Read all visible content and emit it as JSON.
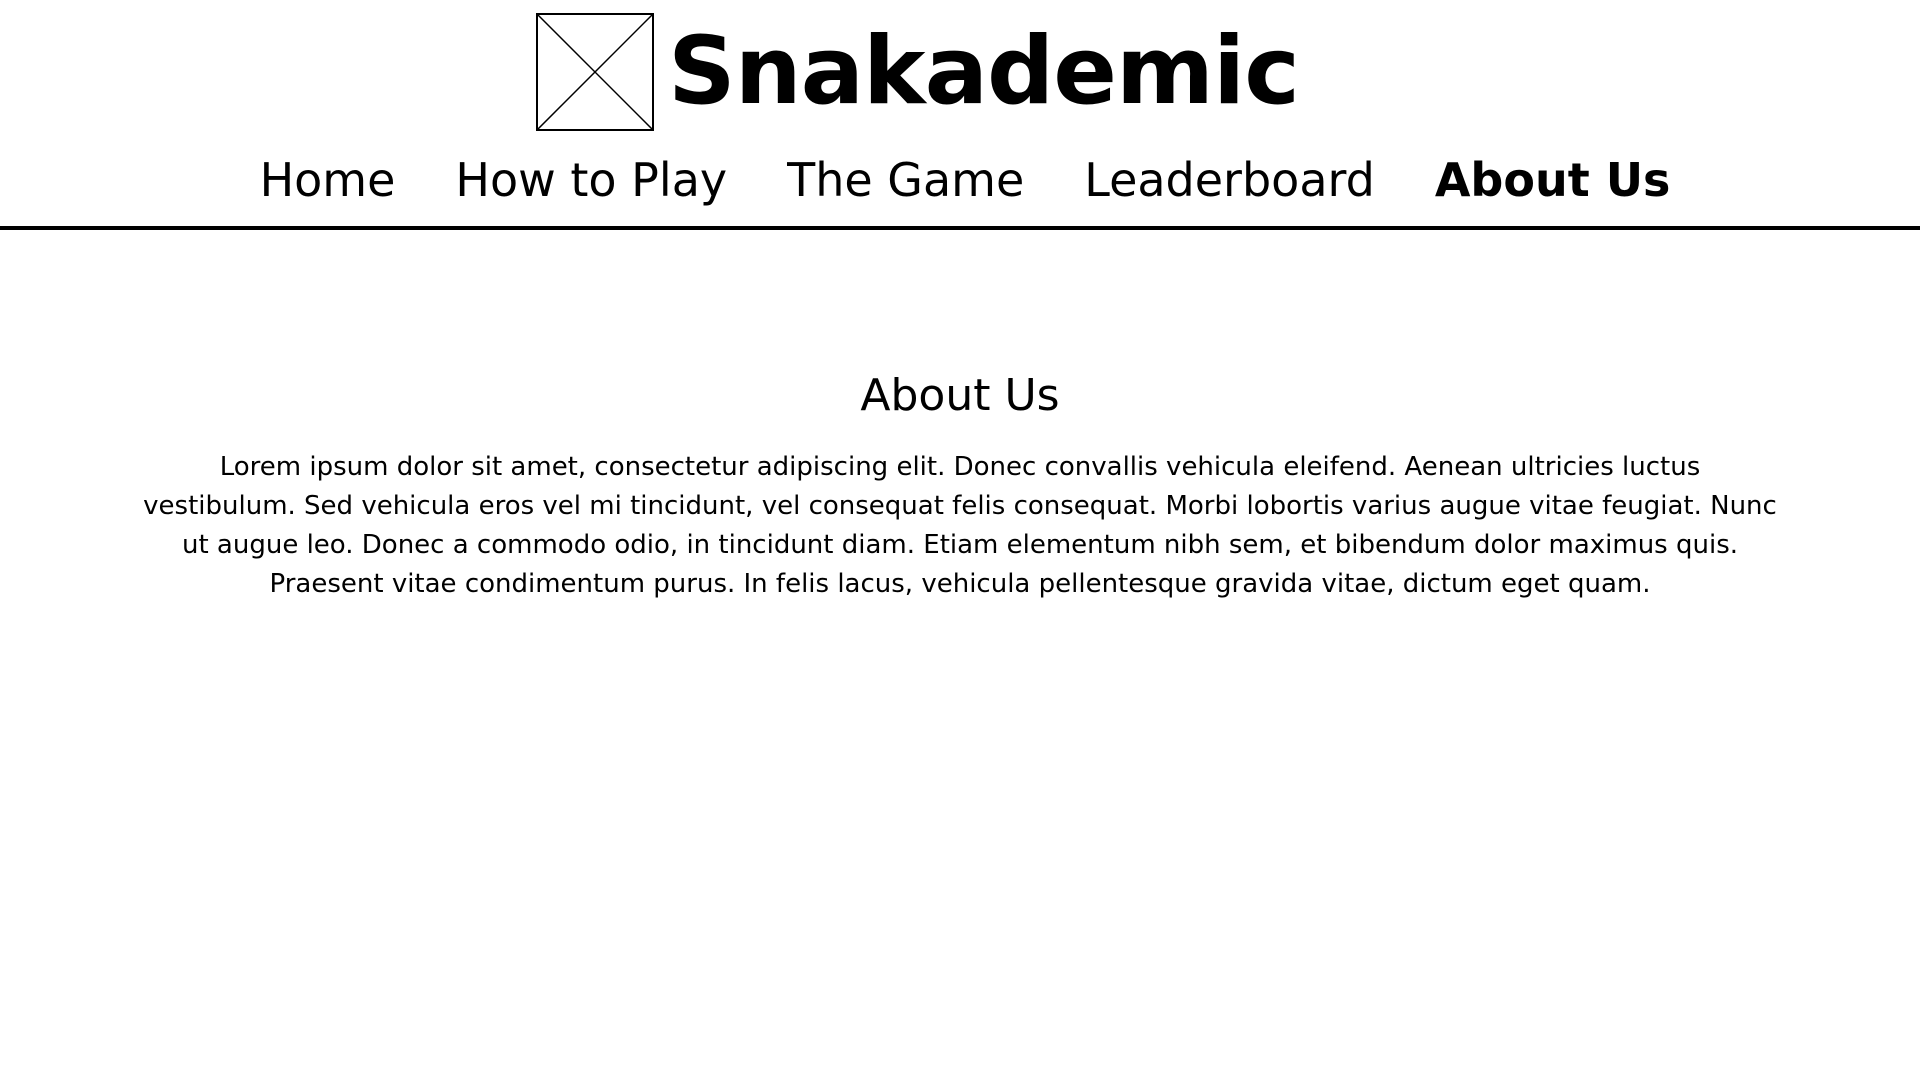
{
  "site": {
    "title": "Snakademic",
    "logo_icon": "image-placeholder-icon"
  },
  "nav": {
    "items": [
      {
        "label": "Home",
        "active": false
      },
      {
        "label": "How to Play",
        "active": false
      },
      {
        "label": "The Game",
        "active": false
      },
      {
        "label": "Leaderboard",
        "active": false
      },
      {
        "label": "About Us",
        "active": true
      }
    ]
  },
  "main": {
    "heading": "About Us",
    "paragraph": "Lorem ipsum dolor sit amet, consectetur adipiscing elit. Donec convallis vehicula eleifend. Aenean ultricies luctus vestibulum. Sed vehicula eros vel mi tincidunt, vel consequat felis consequat. Morbi lobortis varius augue vitae feugiat. Nunc ut augue leo. Donec a commodo odio, in tincidunt diam. Etiam elementum nibh sem, et bibendum dolor maximus quis. Praesent vitae condimentum purus. In felis lacus, vehicula pellentesque gravida vitae, dictum eget quam."
  },
  "colors": {
    "background": "#ffffff",
    "text": "#000000",
    "divider": "#000000"
  }
}
